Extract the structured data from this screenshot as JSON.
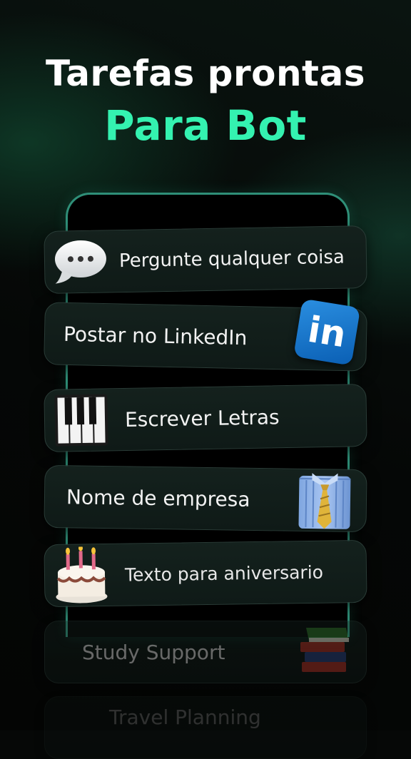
{
  "header": {
    "line1": "Tarefas prontas",
    "line2": "Para Bot"
  },
  "colors": {
    "accent": "#34f2b0",
    "phone_border": "#2f8f78",
    "card_bg": "#14211d"
  },
  "tasks": [
    {
      "label": "Pergunte qualquer coisa",
      "icon": "speech-bubble-icon"
    },
    {
      "label": "Postar no LinkedIn",
      "icon": "linkedin-icon",
      "icon_text": "in"
    },
    {
      "label": "Escrever Letras",
      "icon": "piano-keys-icon"
    },
    {
      "label": "Nome de empresa",
      "icon": "shirt-tie-icon"
    },
    {
      "label": "Texto para aniversario",
      "icon": "birthday-cake-icon"
    },
    {
      "label": "Study Support",
      "icon": "books-icon"
    },
    {
      "label": "Travel Planning",
      "icon": ""
    }
  ]
}
